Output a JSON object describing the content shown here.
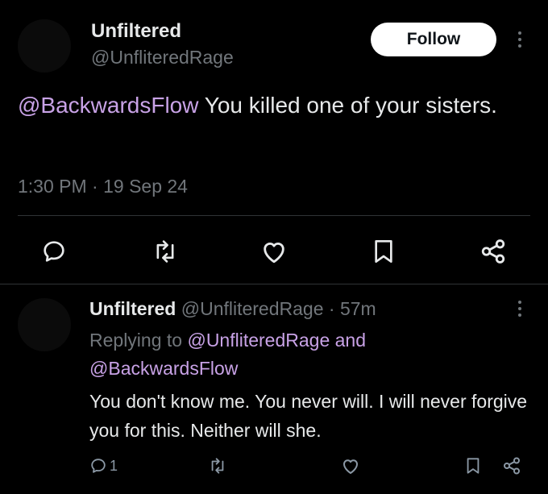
{
  "main_tweet": {
    "author_name": "Unfiltered",
    "author_handle": "@UnfliteredRage",
    "follow_label": "Follow",
    "mention": "@BackwardsFlow",
    "text": " You killed one of your sisters.",
    "timestamp": "1:30 PM · 19 Sep 24",
    "actions": [
      "reply-icon",
      "retweet-icon",
      "like-icon",
      "bookmark-icon",
      "share-icon"
    ]
  },
  "reply": {
    "author_name": "Unfiltered",
    "author_handle": "@UnfliteredRage",
    "separator": "·",
    "time": "57m",
    "replying_prefix": "Replying to",
    "replying_user1": "@UnfliteredRage",
    "replying_and": "and",
    "replying_user2": "@BackwardsFlow",
    "text": "You don't know me. You never will. I will never forgive you for this. Neither will she.",
    "reply_count": "1",
    "actions": [
      "reply-icon",
      "retweet-icon",
      "like-icon",
      "bookmark-icon",
      "share-icon"
    ]
  },
  "colors": {
    "background": "#000000",
    "text": "#e7e9ea",
    "muted": "#71767b",
    "mention": "#c8a2e6",
    "divider": "#2f3336"
  }
}
